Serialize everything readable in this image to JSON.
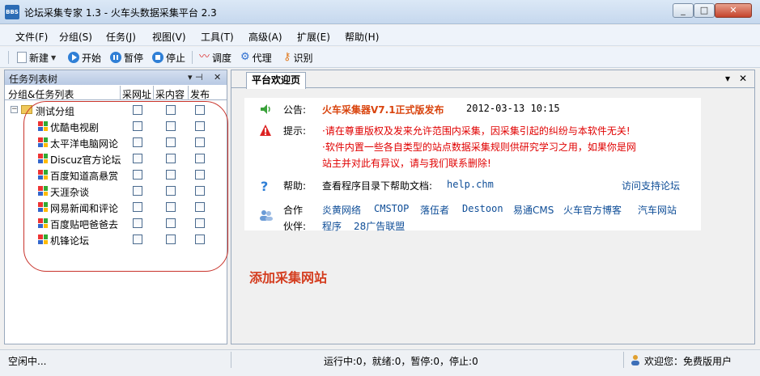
{
  "window": {
    "title": "论坛采集专家 1.3 - 火车头数据采集平台 2.3",
    "icon_text": "BBS",
    "controls": [
      "_",
      "□",
      "✕"
    ]
  },
  "menu": [
    "文件(F)",
    "分组(S)",
    "任务(J)",
    "视图(V)",
    "工具(T)",
    "高级(A)",
    "扩展(E)",
    "帮助(H)"
  ],
  "toolbar": {
    "new": "新建",
    "start": "开始",
    "pause": "暂停",
    "stop": "停止",
    "schedule": "调度",
    "proxy": "代理",
    "recognize": "识别"
  },
  "left_panel": {
    "title": "任务列表树",
    "pin": "▾ ⊣",
    "close": "✕",
    "columns": [
      "分组&任务列表",
      "采网址",
      "采内容",
      "发布"
    ],
    "group": "测试分组",
    "tasks": [
      "优酷电视剧",
      "太平洋电脑网论",
      "Discuz官方论坛",
      "百度知道高悬赏",
      "天涯杂谈",
      "网易新闻和评论",
      "百度贴吧爸爸去",
      "机锋论坛"
    ]
  },
  "right_panel": {
    "tab": "平台欢迎页",
    "tab_menu": "▾",
    "tab_close": "✕",
    "notice_label": "公告:",
    "notice_title": "火车采集器V7.1正式版发布",
    "notice_date": "2012-03-13 10:15",
    "tip_label": "提示:",
    "tip_line1": "·请在尊重版权及发来允许范围内采集，因采集引起的纠纷与本软件无关!",
    "tip_line2": "·软件内置一些各自类型的站点数据采集规则供研究学习之用，如果你是网",
    "tip_line3": "站主并对此有异议，请与我们联系删除!",
    "help_label": "帮助:",
    "help_text": "查看程序目录下帮助文档:",
    "help_file": "help.chm",
    "support_link": "访问支持论坛",
    "partner_label_1": "合作",
    "partner_label_2": "伙伴:",
    "partners_row1": [
      "炎黄网络",
      "CMSTOP",
      "落伍者",
      "Destoon",
      "易通CMS",
      "火车官方博客",
      "汽车网站"
    ],
    "partners_row2": [
      "程序",
      "28广告联盟"
    ]
  },
  "annotation": "添加采集网站",
  "status": {
    "left": "空闲中...",
    "middle": "运行中:0，就绪:0，暂停:0，停止:0",
    "right": "欢迎您：免费版用户"
  },
  "colors": {
    "annotation": "#d43d1f",
    "notice_title": "#d9450f",
    "tip": "#e00000",
    "link": "#0e4d97",
    "oval": "#c8332b"
  }
}
